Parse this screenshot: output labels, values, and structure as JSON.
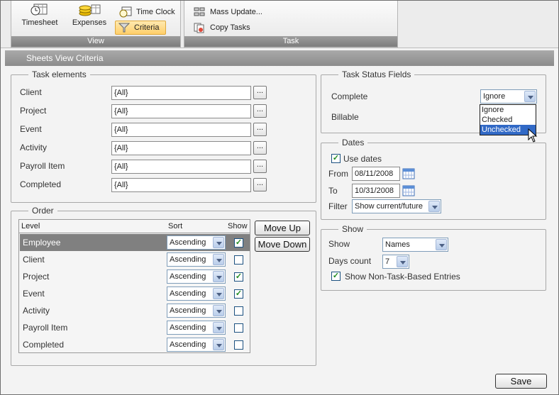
{
  "ribbon": {
    "view": {
      "caption": "View",
      "timesheet": "Timesheet",
      "expenses": "Expenses",
      "time_clock": "Time Clock",
      "criteria": "Criteria"
    },
    "task": {
      "caption": "Task",
      "mass_update": "Mass Update...",
      "copy_tasks": "Copy Tasks"
    }
  },
  "panel_title": "Sheets View Criteria",
  "task_elements": {
    "legend": "Task elements",
    "fields": [
      {
        "label": "Client",
        "value": "{All}",
        "btn": "..."
      },
      {
        "label": "Project",
        "value": "{All}",
        "btn": "..."
      },
      {
        "label": "Event",
        "value": "{All}",
        "btn": "..."
      },
      {
        "label": "Activity",
        "value": "{All}",
        "btn": "..."
      },
      {
        "label": "Payroll Item",
        "value": "{All}",
        "btn": "..."
      },
      {
        "label": "Completed",
        "value": "{All}",
        "btn": "..."
      }
    ]
  },
  "order": {
    "legend": "Order",
    "headers": {
      "level": "Level",
      "sort": "Sort",
      "show": "Show"
    },
    "rows": [
      {
        "level": "Employee",
        "sort": "Ascending",
        "show": true,
        "selected": true
      },
      {
        "level": "Client",
        "sort": "Ascending",
        "show": false
      },
      {
        "level": "Project",
        "sort": "Ascending",
        "show": true
      },
      {
        "level": "Event",
        "sort": "Ascending",
        "show": true
      },
      {
        "level": "Activity",
        "sort": "Ascending",
        "show": false
      },
      {
        "level": "Payroll Item",
        "sort": "Ascending",
        "show": false
      },
      {
        "level": "Completed",
        "sort": "Ascending",
        "show": false
      }
    ],
    "move_up": "Move Up",
    "move_down": "Move Down"
  },
  "status_fields": {
    "legend": "Task Status Fields",
    "complete_label": "Complete",
    "complete_value": "Ignore",
    "billable_label": "Billable",
    "dropdown_options": [
      "Ignore",
      "Checked",
      "Unchecked"
    ],
    "highlighted_option": "Unchecked"
  },
  "dates": {
    "legend": "Dates",
    "use_dates_label": "Use dates",
    "use_dates": true,
    "from_label": "From",
    "from_value": "08/11/2008",
    "to_label": "To",
    "to_value": "10/31/2008",
    "filter_label": "Filter",
    "filter_value": "Show current/future"
  },
  "show": {
    "legend": "Show",
    "show_label": "Show",
    "show_value": "Names",
    "days_label": "Days count",
    "days_value": "7",
    "non_task_label": "Show Non-Task-Based Entries",
    "non_task": true
  },
  "save_label": "Save",
  "colors": {
    "selected_row": "#808080",
    "title_bar": "#9a9a9a",
    "dropdown_highlight": "#3169c6",
    "check": "#1f8a1f"
  }
}
